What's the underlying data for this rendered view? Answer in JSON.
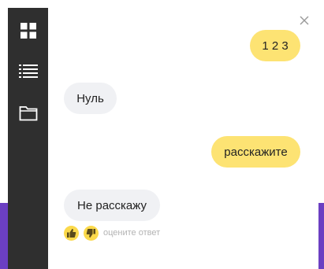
{
  "sidebar": {
    "items": [
      {
        "icon": "grid-icon"
      },
      {
        "icon": "list-icon"
      },
      {
        "icon": "folder-icon"
      }
    ]
  },
  "chat": {
    "messages": [
      {
        "from": "user",
        "text": "1 2 3"
      },
      {
        "from": "bot",
        "text": "Нуль"
      },
      {
        "from": "user",
        "text": "расскажите"
      },
      {
        "from": "bot",
        "text": "Не расскажу"
      }
    ],
    "rating_label": "оцените ответ"
  },
  "colors": {
    "user_bubble": "#fde373",
    "bot_bubble": "#f0f1f4",
    "sidebar": "#2f2f2f",
    "backdrop": "#6b3fc2",
    "rating_button": "#fbd94b"
  }
}
